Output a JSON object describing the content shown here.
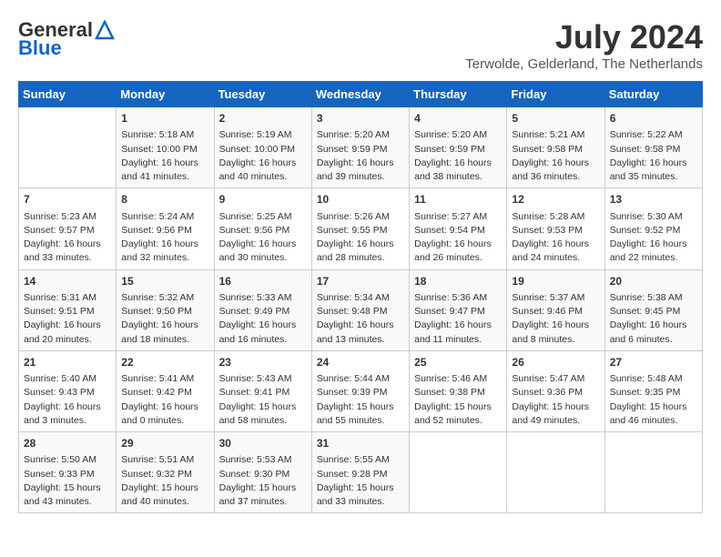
{
  "header": {
    "logo_general": "General",
    "logo_blue": "Blue",
    "month_title": "July 2024",
    "location": "Terwolde, Gelderland, The Netherlands"
  },
  "days_of_week": [
    "Sunday",
    "Monday",
    "Tuesday",
    "Wednesday",
    "Thursday",
    "Friday",
    "Saturday"
  ],
  "weeks": [
    [
      {
        "day": "",
        "content": ""
      },
      {
        "day": "1",
        "content": "Sunrise: 5:18 AM\nSunset: 10:00 PM\nDaylight: 16 hours\nand 41 minutes."
      },
      {
        "day": "2",
        "content": "Sunrise: 5:19 AM\nSunset: 10:00 PM\nDaylight: 16 hours\nand 40 minutes."
      },
      {
        "day": "3",
        "content": "Sunrise: 5:20 AM\nSunset: 9:59 PM\nDaylight: 16 hours\nand 39 minutes."
      },
      {
        "day": "4",
        "content": "Sunrise: 5:20 AM\nSunset: 9:59 PM\nDaylight: 16 hours\nand 38 minutes."
      },
      {
        "day": "5",
        "content": "Sunrise: 5:21 AM\nSunset: 9:58 PM\nDaylight: 16 hours\nand 36 minutes."
      },
      {
        "day": "6",
        "content": "Sunrise: 5:22 AM\nSunset: 9:58 PM\nDaylight: 16 hours\nand 35 minutes."
      }
    ],
    [
      {
        "day": "7",
        "content": "Sunrise: 5:23 AM\nSunset: 9:57 PM\nDaylight: 16 hours\nand 33 minutes."
      },
      {
        "day": "8",
        "content": "Sunrise: 5:24 AM\nSunset: 9:56 PM\nDaylight: 16 hours\nand 32 minutes."
      },
      {
        "day": "9",
        "content": "Sunrise: 5:25 AM\nSunset: 9:56 PM\nDaylight: 16 hours\nand 30 minutes."
      },
      {
        "day": "10",
        "content": "Sunrise: 5:26 AM\nSunset: 9:55 PM\nDaylight: 16 hours\nand 28 minutes."
      },
      {
        "day": "11",
        "content": "Sunrise: 5:27 AM\nSunset: 9:54 PM\nDaylight: 16 hours\nand 26 minutes."
      },
      {
        "day": "12",
        "content": "Sunrise: 5:28 AM\nSunset: 9:53 PM\nDaylight: 16 hours\nand 24 minutes."
      },
      {
        "day": "13",
        "content": "Sunrise: 5:30 AM\nSunset: 9:52 PM\nDaylight: 16 hours\nand 22 minutes."
      }
    ],
    [
      {
        "day": "14",
        "content": "Sunrise: 5:31 AM\nSunset: 9:51 PM\nDaylight: 16 hours\nand 20 minutes."
      },
      {
        "day": "15",
        "content": "Sunrise: 5:32 AM\nSunset: 9:50 PM\nDaylight: 16 hours\nand 18 minutes."
      },
      {
        "day": "16",
        "content": "Sunrise: 5:33 AM\nSunset: 9:49 PM\nDaylight: 16 hours\nand 16 minutes."
      },
      {
        "day": "17",
        "content": "Sunrise: 5:34 AM\nSunset: 9:48 PM\nDaylight: 16 hours\nand 13 minutes."
      },
      {
        "day": "18",
        "content": "Sunrise: 5:36 AM\nSunset: 9:47 PM\nDaylight: 16 hours\nand 11 minutes."
      },
      {
        "day": "19",
        "content": "Sunrise: 5:37 AM\nSunset: 9:46 PM\nDaylight: 16 hours\nand 8 minutes."
      },
      {
        "day": "20",
        "content": "Sunrise: 5:38 AM\nSunset: 9:45 PM\nDaylight: 16 hours\nand 6 minutes."
      }
    ],
    [
      {
        "day": "21",
        "content": "Sunrise: 5:40 AM\nSunset: 9:43 PM\nDaylight: 16 hours\nand 3 minutes."
      },
      {
        "day": "22",
        "content": "Sunrise: 5:41 AM\nSunset: 9:42 PM\nDaylight: 16 hours\nand 0 minutes."
      },
      {
        "day": "23",
        "content": "Sunrise: 5:43 AM\nSunset: 9:41 PM\nDaylight: 15 hours\nand 58 minutes."
      },
      {
        "day": "24",
        "content": "Sunrise: 5:44 AM\nSunset: 9:39 PM\nDaylight: 15 hours\nand 55 minutes."
      },
      {
        "day": "25",
        "content": "Sunrise: 5:46 AM\nSunset: 9:38 PM\nDaylight: 15 hours\nand 52 minutes."
      },
      {
        "day": "26",
        "content": "Sunrise: 5:47 AM\nSunset: 9:36 PM\nDaylight: 15 hours\nand 49 minutes."
      },
      {
        "day": "27",
        "content": "Sunrise: 5:48 AM\nSunset: 9:35 PM\nDaylight: 15 hours\nand 46 minutes."
      }
    ],
    [
      {
        "day": "28",
        "content": "Sunrise: 5:50 AM\nSunset: 9:33 PM\nDaylight: 15 hours\nand 43 minutes."
      },
      {
        "day": "29",
        "content": "Sunrise: 5:51 AM\nSunset: 9:32 PM\nDaylight: 15 hours\nand 40 minutes."
      },
      {
        "day": "30",
        "content": "Sunrise: 5:53 AM\nSunset: 9:30 PM\nDaylight: 15 hours\nand 37 minutes."
      },
      {
        "day": "31",
        "content": "Sunrise: 5:55 AM\nSunset: 9:28 PM\nDaylight: 15 hours\nand 33 minutes."
      },
      {
        "day": "",
        "content": ""
      },
      {
        "day": "",
        "content": ""
      },
      {
        "day": "",
        "content": ""
      }
    ]
  ]
}
